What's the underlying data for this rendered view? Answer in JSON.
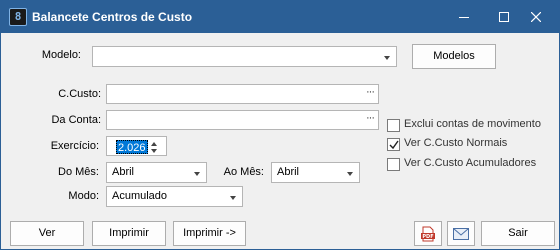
{
  "window": {
    "title": "Balancete Centros de Custo",
    "app_icon_glyph": "8",
    "title_color": "#2b5f96"
  },
  "form": {
    "modelo": {
      "label": "Modelo:",
      "value": "",
      "button": "Modelos"
    },
    "ccusto": {
      "label": "C.Custo:",
      "value": "",
      "lookup": "···"
    },
    "da_conta": {
      "label": "Da Conta:",
      "value": "",
      "lookup": "···"
    },
    "exercicio": {
      "label": "Exercício:",
      "value": "2.026"
    },
    "do_mes": {
      "label": "Do Mês:",
      "value": "Abril"
    },
    "ao_mes": {
      "label": "Ao Mês:",
      "value": "Abril"
    },
    "modo": {
      "label": "Modo:",
      "value": "Acumulado"
    }
  },
  "options": {
    "exclui": {
      "label": "Exclui contas de movimento",
      "checked": false
    },
    "normais": {
      "label": "Ver C.Custo Normais",
      "checked": true
    },
    "acumuladores": {
      "label": "Ver C.Custo Acumuladores",
      "checked": false
    }
  },
  "buttons": {
    "ver": "Ver",
    "imprimir": "Imprimir",
    "imprimir_para": "Imprimir ->",
    "pdf_icon": "pdf-icon",
    "mail_icon": "envelope-icon",
    "sair": "Sair"
  }
}
